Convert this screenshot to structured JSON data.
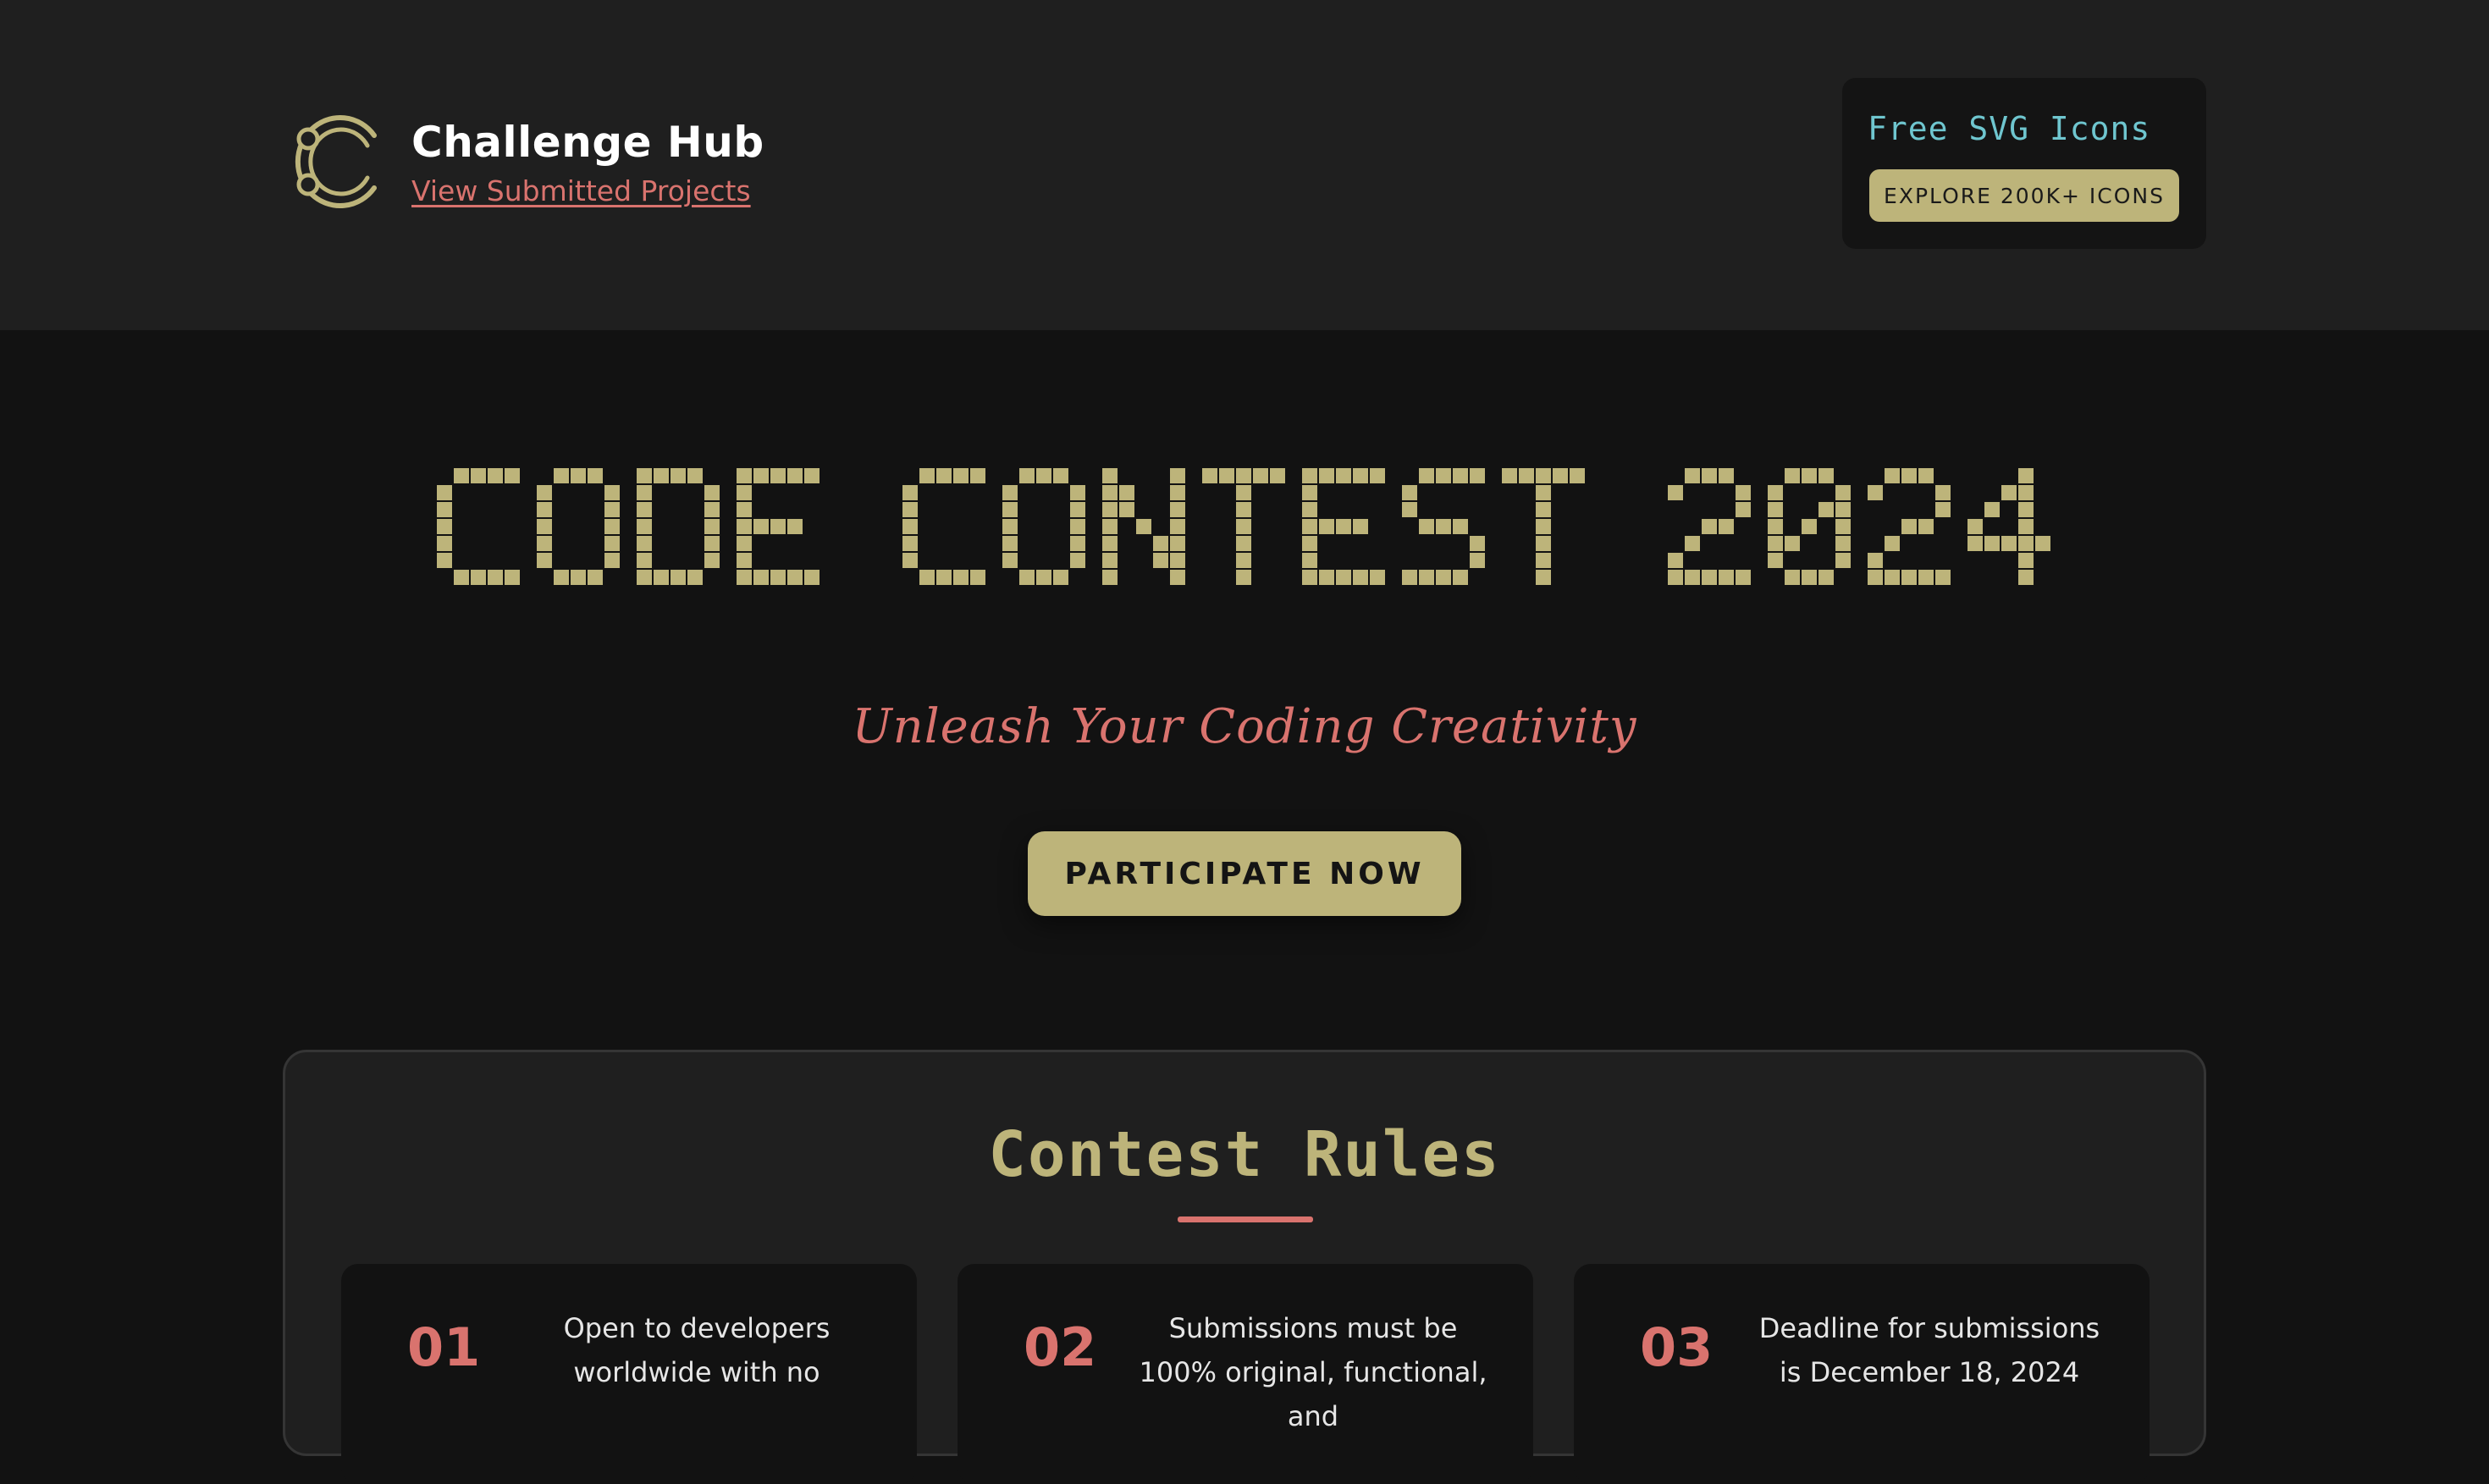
{
  "header": {
    "brand_title": "Challenge Hub",
    "brand_link": "View Submitted Projects",
    "promo": {
      "title": "Free SVG Icons",
      "button_label": "EXPLORE 200K+ ICONS"
    }
  },
  "hero": {
    "title": "CODE CONTEST 2024",
    "tagline": "Unleash Your Coding Creativity",
    "cta_label": "PARTICIPATE NOW"
  },
  "rules": {
    "title": "Contest Rules",
    "items": [
      {
        "number": "01",
        "text": "Open to developers worldwide with no"
      },
      {
        "number": "02",
        "text": "Submissions must be 100% original, functional, and"
      },
      {
        "number": "03",
        "text": "Deadline for submissions is December 18, 2024"
      }
    ]
  },
  "colors": {
    "accent_khaki": "#bdb47a",
    "accent_salmon": "#d9736e",
    "promo_title_cyan": "#6fc6cf",
    "header_bg": "#1f1f1f",
    "page_bg": "#121212"
  },
  "icons": {
    "logo": "challenge-hub-logo-icon"
  }
}
